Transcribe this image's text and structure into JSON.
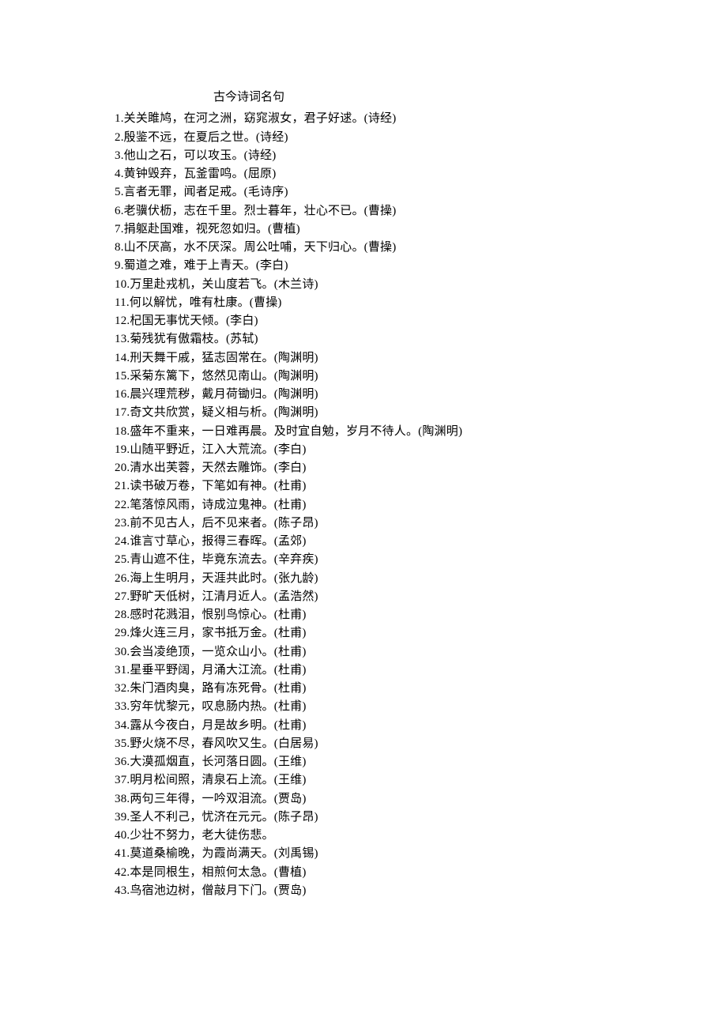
{
  "title": "古今诗词名句",
  "lines": [
    "1.关关雎鸠，在河之洲，窈窕淑女，君子好逑。(诗经)",
    "2.殷鉴不远，在夏后之世。(诗经)",
    "3.他山之石，可以攻玉。(诗经)",
    "4.黄钟毁弃，瓦釜雷鸣。(屈原)",
    "5.言者无罪，闻者足戒。(毛诗序)",
    "6.老骥伏枥，志在千里。烈士暮年，壮心不已。(曹操)",
    "7.捐躯赴国难，视死忽如归。(曹植)",
    "8.山不厌高，水不厌深。周公吐哺，天下归心。(曹操)",
    "9.蜀道之难，难于上青天。(李白)",
    "10.万里赴戎机，关山度若飞。(木兰诗)",
    "11.何以解忧，唯有杜康。(曹操)",
    "12.杞国无事忧天倾。(李白)",
    "13.菊残犹有傲霜枝。(苏轼)",
    "14.刑天舞干戚，猛志固常在。(陶渊明)",
    "15.采菊东篱下，悠然见南山。(陶渊明)",
    "16.晨兴理荒秽，戴月荷锄归。(陶渊明)",
    "17.奇文共欣赏，疑义相与析。(陶渊明)",
    "18.盛年不重来，一日难再晨。及时宜自勉，岁月不待人。(陶渊明)",
    "19.山随平野近，江入大荒流。(李白)",
    "20.清水出芙蓉，天然去雕饰。(李白)",
    "21.读书破万卷，下笔如有神。(杜甫)",
    "22.笔落惊风雨，诗成泣鬼神。(杜甫)",
    "23.前不见古人，后不见来者。(陈子昂)",
    "24.谁言寸草心，报得三春晖。(孟郊)",
    "25.青山遮不住，毕竟东流去。(辛弃疾)",
    "26.海上生明月，天涯共此时。(张九龄)",
    "27.野旷天低树，江清月近人。(孟浩然)",
    "28.感时花溅泪，恨别鸟惊心。(杜甫)",
    "29.烽火连三月，家书抵万金。(杜甫)",
    "30.会当凌绝顶，一览众山小。(杜甫)",
    "31.星垂平野阔，月涌大江流。(杜甫)",
    "32.朱门酒肉臭，路有冻死骨。(杜甫)",
    "33.穷年忧黎元，叹息肠内热。(杜甫)",
    "34.露从今夜白，月是故乡明。(杜甫)",
    "35.野火烧不尽，春风吹又生。(白居易)",
    "36.大漠孤烟直，长河落日圆。(王维)",
    "37.明月松间照，清泉石上流。(王维)",
    "38.两句三年得，一吟双泪流。(贾岛)",
    "39.圣人不利己，忧济在元元。(陈子昂)",
    "40.少壮不努力，老大徒伤悲。",
    "41.莫道桑榆晚，为霞尚满天。(刘禹锡)",
    "42.本是同根生，相煎何太急。(曹植)",
    "43.鸟宿池边树，僧敲月下门。(贾岛)"
  ]
}
